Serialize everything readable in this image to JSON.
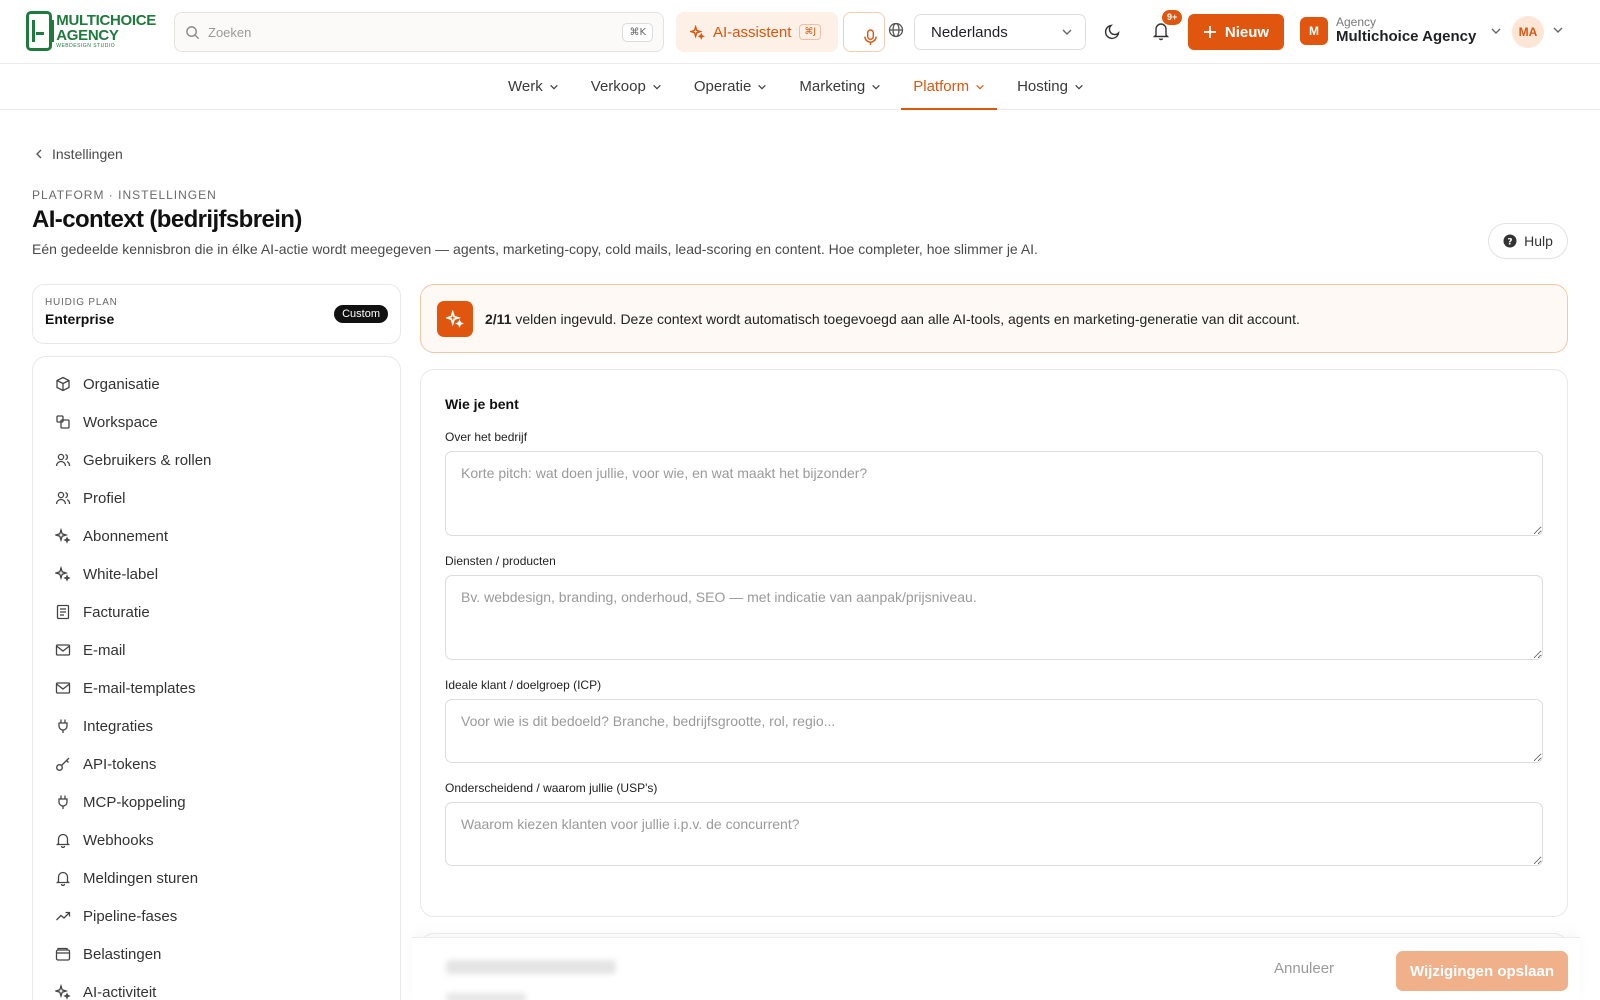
{
  "brand": {
    "line1": "MULTICHOICE",
    "line2": "AGENCY",
    "line3": "WEBDESIGN STUDIO",
    "color": "#1f7a3d"
  },
  "header": {
    "search_placeholder": "Zoeken",
    "search_shortcut": "⌘K",
    "ai_label": "AI-assistent",
    "ai_shortcut": "⌘J",
    "language": "Nederlands",
    "notifications_badge": "9+",
    "new_label": "Nieuw",
    "agency_label": "Agency",
    "agency_name": "Multichoice Agency",
    "agency_initial": "M",
    "user_initials": "MA",
    "accent": "#e0560f"
  },
  "nav": {
    "items": [
      {
        "label": "Werk"
      },
      {
        "label": "Verkoop"
      },
      {
        "label": "Operatie"
      },
      {
        "label": "Marketing"
      },
      {
        "label": "Platform",
        "active": true
      },
      {
        "label": "Hosting"
      }
    ]
  },
  "page": {
    "back_label": "Instellingen",
    "eyebrow": "PLATFORM · INSTELLINGEN",
    "title": "AI-context (bedrijfsbrein)",
    "description": "Eén gedeelde kennisbron die in élke AI-actie wordt meegegeven — agents, marketing-copy, cold mails, lead-scoring en content. Hoe completer, hoe slimmer je AI.",
    "help_label": "Hulp"
  },
  "plan": {
    "label": "HUIDIG PLAN",
    "name": "Enterprise",
    "badge": "Custom"
  },
  "sidebar": {
    "items": [
      {
        "label": "Organisatie",
        "icon": "cube-icon"
      },
      {
        "label": "Workspace",
        "icon": "workspace-icon"
      },
      {
        "label": "Gebruikers & rollen",
        "icon": "users-icon"
      },
      {
        "label": "Profiel",
        "icon": "users-icon"
      },
      {
        "label": "Abonnement",
        "icon": "sparkle-icon"
      },
      {
        "label": "White-label",
        "icon": "sparkle-icon"
      },
      {
        "label": "Facturatie",
        "icon": "document-icon"
      },
      {
        "label": "E-mail",
        "icon": "mail-icon"
      },
      {
        "label": "E-mail-templates",
        "icon": "mail-icon"
      },
      {
        "label": "Integraties",
        "icon": "plug-icon"
      },
      {
        "label": "API-tokens",
        "icon": "key-icon"
      },
      {
        "label": "MCP-koppeling",
        "icon": "plug-icon"
      },
      {
        "label": "Webhooks",
        "icon": "bell-icon"
      },
      {
        "label": "Meldingen sturen",
        "icon": "bell-icon"
      },
      {
        "label": "Pipeline-fases",
        "icon": "trending-icon"
      },
      {
        "label": "Belastingen",
        "icon": "wallet-icon"
      },
      {
        "label": "AI-activiteit",
        "icon": "sparkle-icon"
      }
    ]
  },
  "banner": {
    "count": "2/11",
    "text": " velden ingevuld. Deze context wordt automatisch toegevoegd aan alle AI-tools, agents en marketing-generatie van dit account."
  },
  "form": {
    "section_title": "Wie je bent",
    "fields": [
      {
        "label": "Over het bedrijf",
        "placeholder": "Korte pitch: wat doen jullie, voor wie, en wat maakt het bijzonder?",
        "value": ""
      },
      {
        "label": "Diensten / producten",
        "placeholder": "Bv. webdesign, branding, onderhoud, SEO — met indicatie van aanpak/prijsniveau.",
        "value": ""
      },
      {
        "label": "Ideale klant / doelgroep (ICP)",
        "placeholder": "Voor wie is dit bedoeld? Branche, bedrijfsgrootte, rol, regio...",
        "value": ""
      },
      {
        "label": "Onderscheidend / waarom jullie (USP's)",
        "placeholder": "Waarom kiezen klanten voor jullie i.p.v. de concurrent?",
        "value": ""
      }
    ]
  },
  "footer": {
    "cancel_label": "Annuleer",
    "save_label": "Wijzigingen opslaan"
  }
}
